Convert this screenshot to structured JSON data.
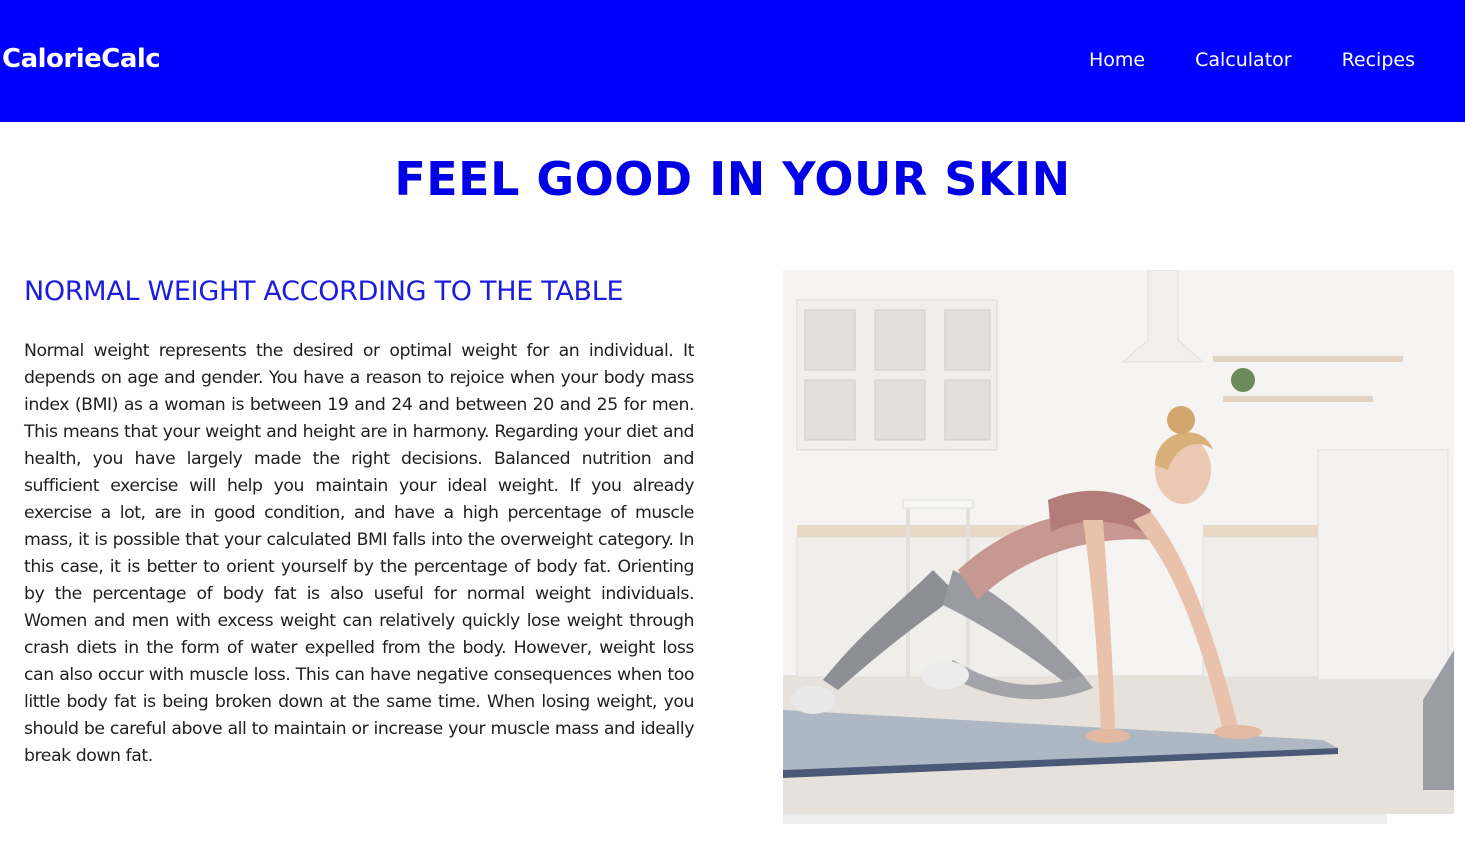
{
  "header": {
    "brand": "CalorieCalc",
    "nav": [
      {
        "label": "Home"
      },
      {
        "label": "Calculator"
      },
      {
        "label": "Recipes"
      }
    ]
  },
  "hero": {
    "title": "FEEL GOOD IN YOUR SKIN"
  },
  "section": {
    "title": "NORMAL WEIGHT ACCORDING TO THE TABLE",
    "body": "Normal weight represents the desired or optimal weight for an individual. It depends on age and gender. You have a reason to rejoice when your body mass index (BMI) as a woman is between 19 and 24 and between 20 and 25 for men. This means that your weight and height are in harmony. Regarding your diet and health, you have largely made the right decisions. Balanced nutrition and sufficient exercise will help you maintain your ideal weight. If you already exercise a lot, are in good condition, and have a high percentage of muscle mass, it is possible that your calculated BMI falls into the overweight category. In this case, it is better to orient yourself by the percentage of body fat. Orienting by the percentage of body fat is also useful for normal weight individuals. Women and men with excess weight can relatively quickly lose weight through crash diets in the form of water expelled from the body. However, weight loss can also occur with muscle loss. This can have negative consequences when too little body fat is being broken down at the same time. When losing weight, you should be careful above all to maintain or increase your muscle mass and ideally break down fat."
  },
  "image": {
    "subject": "woman-exercising-on-yoga-mat-in-kitchen"
  },
  "colors": {
    "nav_bg": "#0000ff",
    "accent": "#0000e6",
    "text": "#1f1f1f"
  }
}
